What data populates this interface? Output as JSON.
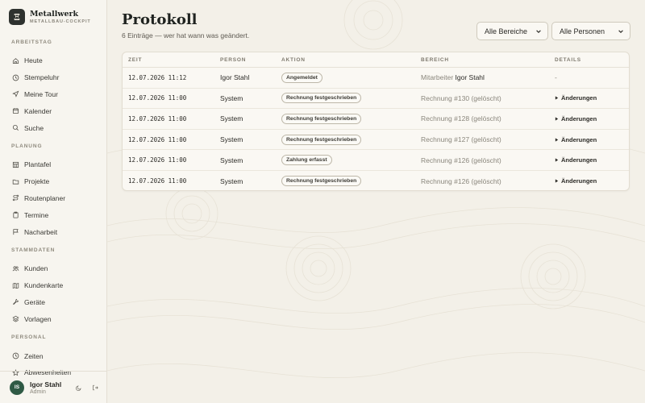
{
  "brand": {
    "name": "Metallwerk",
    "subtitle": "METALLBAU-COCKPIT",
    "logo_glyph": "Ξ"
  },
  "sidebar": {
    "sections": [
      {
        "title": "ARBEITSTAG",
        "items": [
          {
            "label": "Heute",
            "icon": "home-icon"
          },
          {
            "label": "Stempeluhr",
            "icon": "clock-icon"
          },
          {
            "label": "Meine Tour",
            "icon": "navigation-icon"
          },
          {
            "label": "Kalender",
            "icon": "calendar-icon"
          },
          {
            "label": "Suche",
            "icon": "search-icon"
          }
        ]
      },
      {
        "title": "PLANUNG",
        "items": [
          {
            "label": "Plantafel",
            "icon": "grid-icon"
          },
          {
            "label": "Projekte",
            "icon": "folder-icon"
          },
          {
            "label": "Routenplaner",
            "icon": "route-icon"
          },
          {
            "label": "Termine",
            "icon": "clipboard-icon"
          },
          {
            "label": "Nacharbeit",
            "icon": "flag-icon"
          }
        ]
      },
      {
        "title": "STAMMDATEN",
        "items": [
          {
            "label": "Kunden",
            "icon": "users-icon"
          },
          {
            "label": "Kundenkarte",
            "icon": "map-icon"
          },
          {
            "label": "Geräte",
            "icon": "wrench-icon"
          },
          {
            "label": "Vorlagen",
            "icon": "layers-icon"
          }
        ]
      },
      {
        "title": "PERSONAL",
        "items": [
          {
            "label": "Zeiten",
            "icon": "clock-icon"
          },
          {
            "label": "Abwesenheiten",
            "icon": "star-icon"
          }
        ]
      }
    ]
  },
  "user": {
    "initials": "IS",
    "name": "Igor Stahl",
    "role": "Admin"
  },
  "page": {
    "title": "Protokoll",
    "subtitle": "6 Einträge — wer hat wann was geändert."
  },
  "filters": {
    "area": {
      "selected": "Alle Bereiche"
    },
    "person": {
      "selected": "Alle Personen"
    }
  },
  "table": {
    "headers": {
      "time": "ZEIT",
      "person": "PERSON",
      "action": "AKTION",
      "area": "BEREICH",
      "details": "DETAILS"
    },
    "rows": [
      {
        "time": "12.07.2026 11:12",
        "person": "Igor Stahl",
        "action": "Angemeldet",
        "area_prefix": "Mitarbeiter",
        "area_main": "Igor Stahl",
        "area_suffix": "",
        "details": "-"
      },
      {
        "time": "12.07.2026 11:00",
        "person": "System",
        "action": "Rechnung festgeschrieben",
        "area_prefix": "Rechnung",
        "area_main": "#130",
        "area_suffix": "(gelöscht)",
        "details": "Änderungen"
      },
      {
        "time": "12.07.2026 11:00",
        "person": "System",
        "action": "Rechnung festgeschrieben",
        "area_prefix": "Rechnung",
        "area_main": "#128",
        "area_suffix": "(gelöscht)",
        "details": "Änderungen"
      },
      {
        "time": "12.07.2026 11:00",
        "person": "System",
        "action": "Rechnung festgeschrieben",
        "area_prefix": "Rechnung",
        "area_main": "#127",
        "area_suffix": "(gelöscht)",
        "details": "Änderungen"
      },
      {
        "time": "12.07.2026 11:00",
        "person": "System",
        "action": "Zahlung erfasst",
        "area_prefix": "Rechnung",
        "area_main": "#126",
        "area_suffix": "(gelöscht)",
        "details": "Änderungen"
      },
      {
        "time": "12.07.2026 11:00",
        "person": "System",
        "action": "Rechnung festgeschrieben",
        "area_prefix": "Rechnung",
        "area_main": "#126",
        "area_suffix": "(gelöscht)",
        "details": "Änderungen"
      }
    ]
  },
  "colors": {
    "accent": "#2f5a45",
    "logo_bg": "#2e322f",
    "background": "#f3f0e8"
  }
}
